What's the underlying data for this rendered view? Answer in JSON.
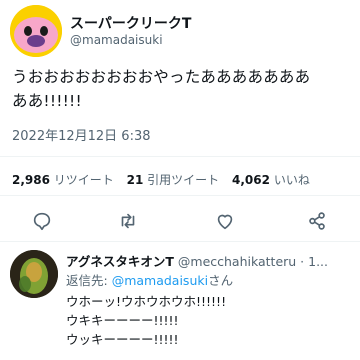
{
  "tweet": {
    "display_name": "スーパークリークT",
    "handle": "@mamadaisuki",
    "text_line1": "うおおおおおおおおやったあああああああ",
    "text_line2": "ああ!!!!!!",
    "timestamp": "2022年12月12日 6:38"
  },
  "stats": {
    "retweets": "2,986",
    "retweets_label": "リツイート",
    "quotes": "21",
    "quotes_label": "引用ツイート",
    "likes": "4,062",
    "likes_label": "いいね"
  },
  "actions": {
    "reply_icon": "comment-icon",
    "retweet_icon": "retweet-icon",
    "like_icon": "heart-icon",
    "share_icon": "share-icon"
  },
  "reply": {
    "display_name": "アグネスタキオンT",
    "handle": "@mecchahikatteru · 1...",
    "reply_to_prefix": "返信先: ",
    "reply_to_handle": "@mamadaisuki",
    "reply_to_suffix": "さん",
    "line1": "ウホーッ!ウホウホウホ!!!!!!",
    "line2": "ウキキーーーー!!!!!",
    "line3": "ウッキーーーー!!!!!"
  },
  "colors": {
    "accent": "#1d9bf0",
    "text": "#0f1419",
    "muted": "#536471",
    "avatar_main_bg": "#fbd000"
  }
}
